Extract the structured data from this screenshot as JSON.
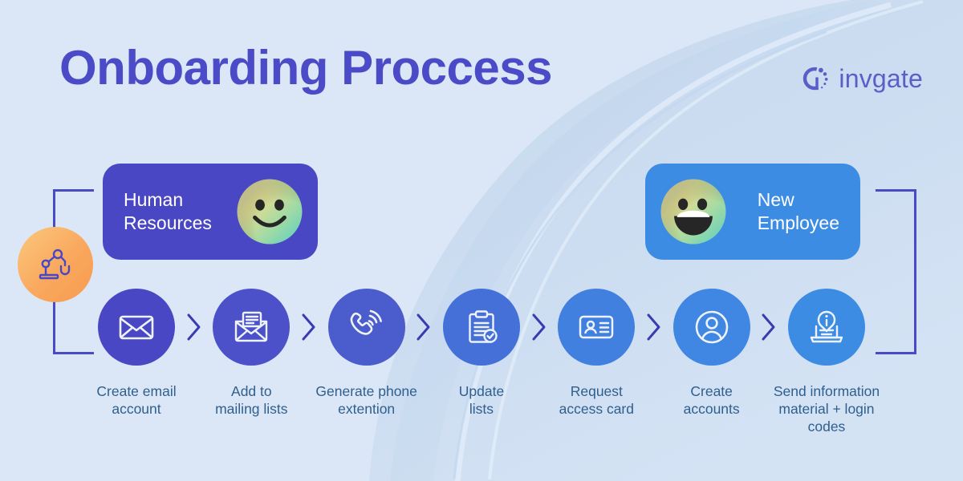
{
  "header": {
    "title": "Onboarding Proccess",
    "title_color": "#4b4bc8",
    "logo_text": "invgate",
    "logo_icon": "invgate-circle-dots-logo"
  },
  "background": {
    "color": "#dbe7f6",
    "brush_color": "#cadcf0"
  },
  "automation": {
    "icon": "robotic-arm-icon",
    "badge_color": "#f9a85e"
  },
  "brackets": {
    "color": "#4a4ac4",
    "left_label": "left-bracket",
    "right_label": "right-bracket"
  },
  "roles": [
    {
      "id": "human-resources",
      "label": "Human\nResources",
      "card_color": "#4a47c4",
      "face": "smiley-face",
      "face_position": "right"
    },
    {
      "id": "new-employee",
      "label": "New\nEmployee",
      "card_color": "#3d8ce4",
      "face": "grinning-face",
      "face_position": "left"
    }
  ],
  "steps": [
    {
      "n": 1,
      "icon": "envelope-icon",
      "label": "Create email\naccount",
      "color": "#4a47c4"
    },
    {
      "n": 2,
      "icon": "open-envelope-icon",
      "label": "Add to\nmailing lists",
      "color": "#4c51ca"
    },
    {
      "n": 3,
      "icon": "phone-ringing-icon",
      "label": "Generate phone\nextention",
      "color": "#4b5ccd"
    },
    {
      "n": 4,
      "icon": "clipboard-check-icon",
      "label": "Update\nlists",
      "color": "#4470d7"
    },
    {
      "n": 5,
      "icon": "id-card-icon",
      "label": "Request\naccess card",
      "color": "#4180de"
    },
    {
      "n": 6,
      "icon": "user-circle-icon",
      "label": "Create\naccounts",
      "color": "#3f87e2"
    },
    {
      "n": 7,
      "icon": "laptop-info-icon",
      "label": "Send information\nmaterial + login\ncodes",
      "color": "#3d8ce4"
    }
  ],
  "chevron": {
    "icon": "chevron-right-icon",
    "color": "#3b3bb0",
    "count": 6
  },
  "label_color": "#2e5f8e"
}
